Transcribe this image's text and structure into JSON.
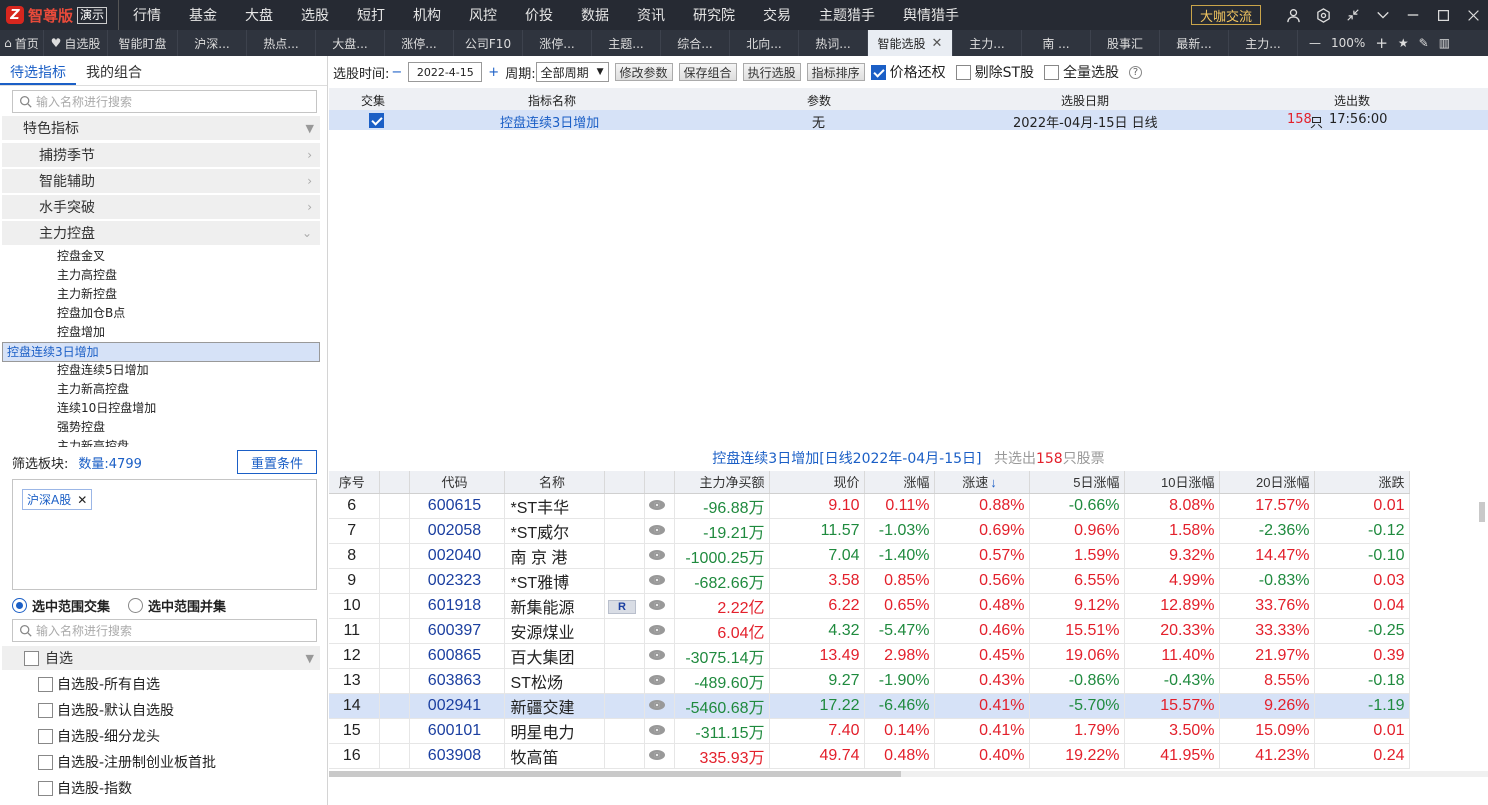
{
  "app": {
    "logo_text": "智尊版",
    "badge": "演示",
    "logo_glyph": "Z",
    "daka": "大咖交流",
    "zoom": "100%"
  },
  "menu": [
    "行情",
    "基金",
    "大盘",
    "选股",
    "短打",
    "机构",
    "风控",
    "价投",
    "数据",
    "资讯",
    "研究院",
    "交易",
    "主题猎手",
    "舆情猎手"
  ],
  "tabs": [
    "首页",
    "自选股",
    "智能盯盘",
    "沪深...",
    "热点...",
    "大盘...",
    "涨停...",
    "公司F10",
    "涨停...",
    "主题...",
    "综合...",
    "北向...",
    "热词...",
    "智能选股",
    "主力...",
    "南 ...",
    "股事汇",
    "最新...",
    "主力..."
  ],
  "left": {
    "tab_active": "待选指标",
    "tab_other": "我的组合",
    "search_placeholder": "输入名称进行搜索",
    "section": "特色指标",
    "groups": [
      "捕捞季节",
      "智能辅助",
      "水手突破",
      "主力控盘"
    ],
    "leaves": [
      "控盘金叉",
      "主力高控盘",
      "主力新控盘",
      "控盘加仓B点",
      "控盘增加",
      "控盘连续3日增加",
      "控盘连续5日增加",
      "主力新高控盘",
      "连续10日控盘增加",
      "强势控盘"
    ],
    "leaves_more": "主力新高控盘",
    "filter_label": "筛选板块:",
    "filter_count": "数量:4799",
    "reset": "重置条件",
    "tag": "沪深A股",
    "tag_close": "✕",
    "radio1": "选中范围交集",
    "radio2": "选中范围并集",
    "search2_placeholder": "输入名称进行搜索",
    "zixuan_head": "自选",
    "zixuan_items": [
      "自选股-所有自选",
      "自选股-默认自选股",
      "自选股-细分龙头",
      "自选股-注册制创业板首批",
      "自选股-指数"
    ]
  },
  "toolbar": {
    "time_label": "选股时间:",
    "minus": "−",
    "date": "2022-4-15",
    "plus": "+",
    "period_label": "周期:",
    "period": "全部周期",
    "btn_modify": "修改参数",
    "btn_save": "保存组合",
    "btn_run": "执行选股",
    "btn_sort": "指标排序",
    "chk1": "价格还权",
    "chk2": "剔除ST股",
    "chk3": "全量选股",
    "help": "?"
  },
  "top_table": {
    "headers": [
      "交集",
      "指标名称",
      "参数",
      "选股日期",
      "选出数"
    ],
    "row": {
      "name": "控盘连续3日增加",
      "param": "无",
      "date": "2022年-04月-15日 日线",
      "count": "158",
      "unit": "只",
      "time": "17:56:00"
    }
  },
  "stat": {
    "title": "控盘连续3日增加[日线2022年-04月-15日]",
    "prefix": "共选出",
    "count": "158",
    "suffix": "只股票"
  },
  "grid": {
    "headers": [
      "序号",
      "",
      "代码",
      "名称",
      "",
      "",
      "主力净买额",
      "现价",
      "涨幅",
      "涨速",
      "5日涨幅",
      "10日涨幅",
      "20日涨幅",
      "涨跌"
    ],
    "sort_mark": "↓",
    "rows": [
      {
        "no": "6",
        "code": "600615",
        "name": "*ST丰华",
        "badge": "",
        "net": "-96.88万",
        "price": "9.10",
        "chg": "0.11%",
        "speed": "0.88%",
        "d5": "-0.66%",
        "d10": "8.08%",
        "d20": "17.57%",
        "diff": "0.01"
      },
      {
        "no": "7",
        "code": "002058",
        "name": "*ST威尔",
        "badge": "",
        "net": "-19.21万",
        "price": "11.57",
        "chg": "-1.03%",
        "speed": "0.69%",
        "d5": "0.96%",
        "d10": "1.58%",
        "d20": "-2.36%",
        "diff": "-0.12"
      },
      {
        "no": "8",
        "code": "002040",
        "name": "南 京 港",
        "badge": "",
        "net": "-1000.25万",
        "price": "7.04",
        "chg": "-1.40%",
        "speed": "0.57%",
        "d5": "1.59%",
        "d10": "9.32%",
        "d20": "14.47%",
        "diff": "-0.10"
      },
      {
        "no": "9",
        "code": "002323",
        "name": "*ST雅博",
        "badge": "",
        "net": "-682.66万",
        "price": "3.58",
        "chg": "0.85%",
        "speed": "0.56%",
        "d5": "6.55%",
        "d10": "4.99%",
        "d20": "-0.83%",
        "diff": "0.03"
      },
      {
        "no": "10",
        "code": "601918",
        "name": "新集能源",
        "badge": "R",
        "net": "2.22亿",
        "price": "6.22",
        "chg": "0.65%",
        "speed": "0.48%",
        "d5": "9.12%",
        "d10": "12.89%",
        "d20": "33.76%",
        "diff": "0.04"
      },
      {
        "no": "11",
        "code": "600397",
        "name": "安源煤业",
        "badge": "",
        "net": "6.04亿",
        "price": "4.32",
        "chg": "-5.47%",
        "speed": "0.46%",
        "d5": "15.51%",
        "d10": "20.33%",
        "d20": "33.33%",
        "diff": "-0.25"
      },
      {
        "no": "12",
        "code": "600865",
        "name": "百大集团",
        "badge": "",
        "net": "-3075.14万",
        "price": "13.49",
        "chg": "2.98%",
        "speed": "0.45%",
        "d5": "19.06%",
        "d10": "11.40%",
        "d20": "21.97%",
        "diff": "0.39"
      },
      {
        "no": "13",
        "code": "603863",
        "name": "ST松炀",
        "badge": "",
        "net": "-489.60万",
        "price": "9.27",
        "chg": "-1.90%",
        "speed": "0.43%",
        "d5": "-0.86%",
        "d10": "-0.43%",
        "d20": "8.55%",
        "diff": "-0.18"
      },
      {
        "no": "14",
        "code": "002941",
        "name": "新疆交建",
        "badge": "",
        "net": "-5460.68万",
        "price": "17.22",
        "chg": "-6.46%",
        "speed": "0.41%",
        "d5": "-5.70%",
        "d10": "15.57%",
        "d20": "9.26%",
        "diff": "-1.19"
      },
      {
        "no": "15",
        "code": "600101",
        "name": "明星电力",
        "badge": "",
        "net": "-311.15万",
        "price": "7.40",
        "chg": "0.14%",
        "speed": "0.41%",
        "d5": "1.79%",
        "d10": "3.50%",
        "d20": "15.09%",
        "diff": "0.01"
      },
      {
        "no": "16",
        "code": "603908",
        "name": "牧高笛",
        "badge": "",
        "net": "335.93万",
        "price": "49.74",
        "chg": "0.48%",
        "speed": "0.40%",
        "d5": "19.22%",
        "d10": "41.95%",
        "d20": "41.23%",
        "diff": "0.24"
      }
    ],
    "highlight_row": "14"
  },
  "colors": {
    "up": "#e3202b",
    "down": "#1f8a3e",
    "accent": "#1b5fc6"
  }
}
